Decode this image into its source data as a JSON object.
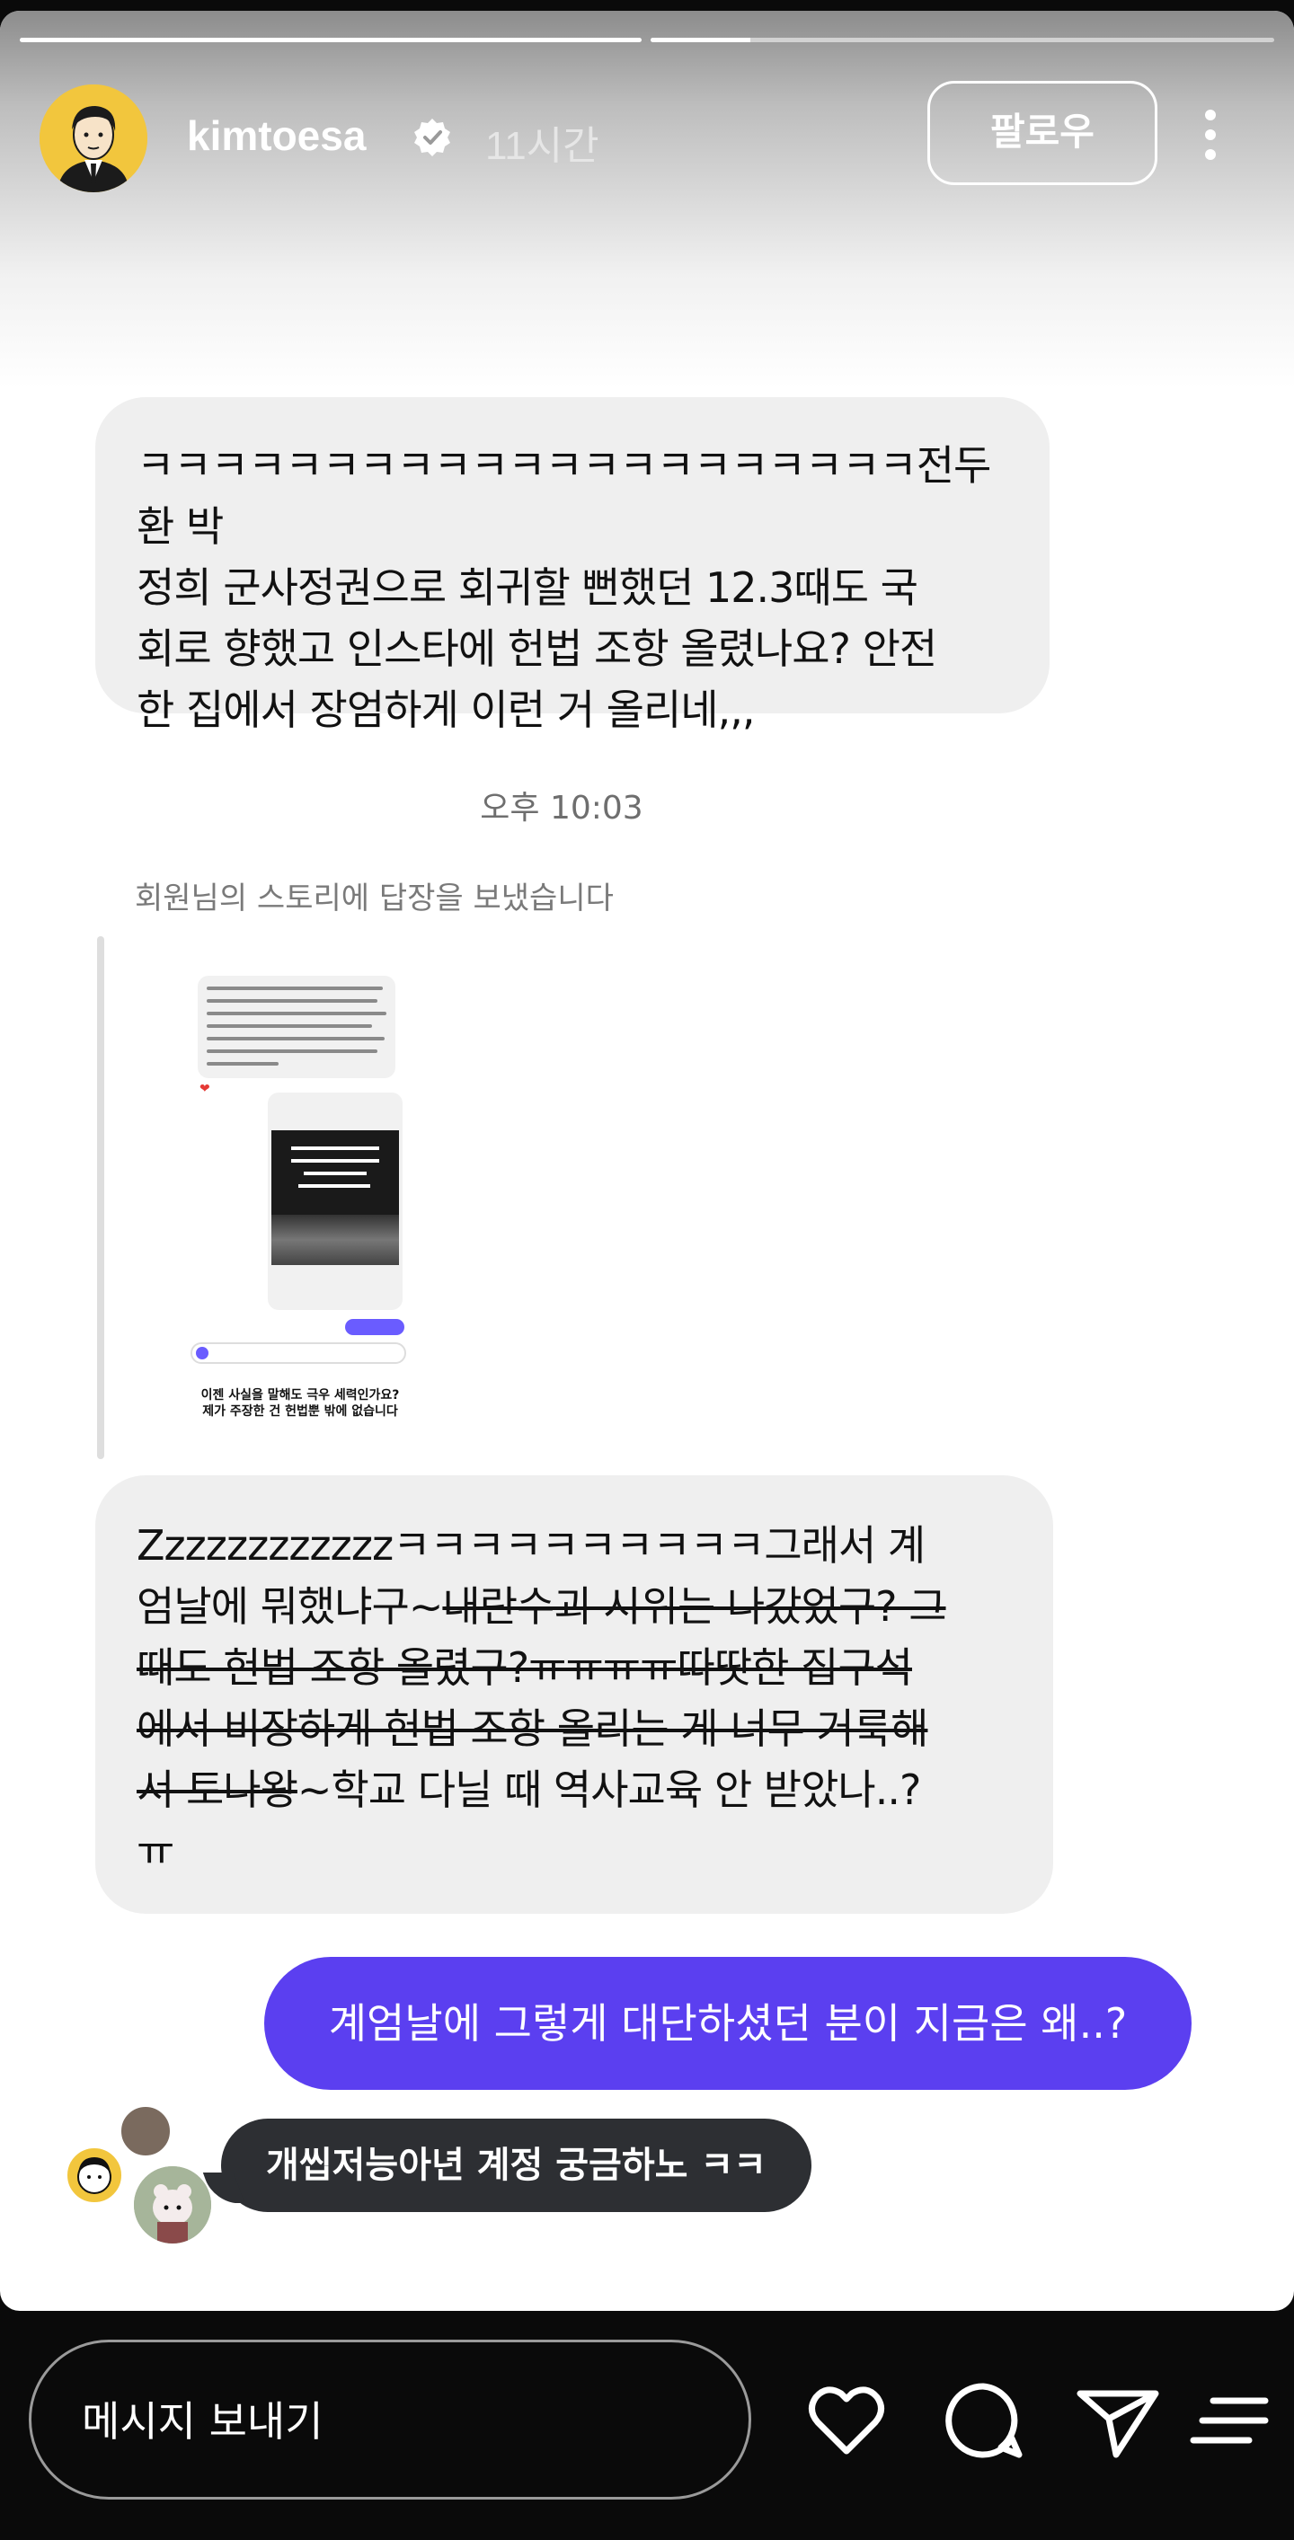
{
  "story": {
    "progress": [
      1.0,
      0.16
    ]
  },
  "header": {
    "username": "kimtoesa",
    "time": "11시간",
    "follow_label": "팔로우",
    "verified_icon": "verified-badge-icon",
    "more_icon": "more-vertical-icon"
  },
  "conversation": {
    "message1": "ㅋㅋㅋㅋㅋㅋㅋㅋㅋㅋㅋㅋㅋㅋㅋㅋㅋㅋㅋㅋㅋ전두환 박\n정희 군사정권으로 회귀할 뻔했던 12.3때도 국\n회로 향했고 인스타에 헌법 조항 올렸나요? 안전\n한 집에서 장엄하게 이런 거 올리네,,,",
    "timestamp": "오후 10:03",
    "reply_note": "회원님의 스토리에 답장을 보냈습니다",
    "story_thumbnail_caption": "이젠 사실을 말해도 극우 세력인가요?\n제가 주장한 건 헌법뿐 밖에 없습니다",
    "message2": {
      "part1": "Zzzzzzzzzzzzㅋㅋㅋㅋㅋㅋㅋㅋㅋㅋ그래서 계\n엄날에 뭐했냐구~",
      "strike1": "내란수괴 시위는 나갔었구? 그\n때도 헌법 조항 올렸구?ㅠㅠㅠㅠ따땃한 집구석\n에서 비장하게 헌법 조항 올리는 게 너무 거룩해\n서 토나왕",
      "part2": "~학교 다닐 때 역사교육 안 받았나..?\nㅠ"
    },
    "sent_message": "계엄날에 그렇게 대단하셨던 분이 지금은 왜..?"
  },
  "overlay_comment": {
    "text": "개씹저능아년 계정 궁금하노 ㅋㅋ"
  },
  "bottom_bar": {
    "input_placeholder": "메시지 보내기",
    "icons": [
      "heart-icon",
      "comment-icon",
      "share-icon",
      "menu-icon"
    ]
  },
  "colors": {
    "sent_bubble": "#5b3ff0",
    "received_bubble": "#efefef",
    "comment_bubble": "#2d2f33",
    "avatar_bg": "#f2c63d"
  }
}
